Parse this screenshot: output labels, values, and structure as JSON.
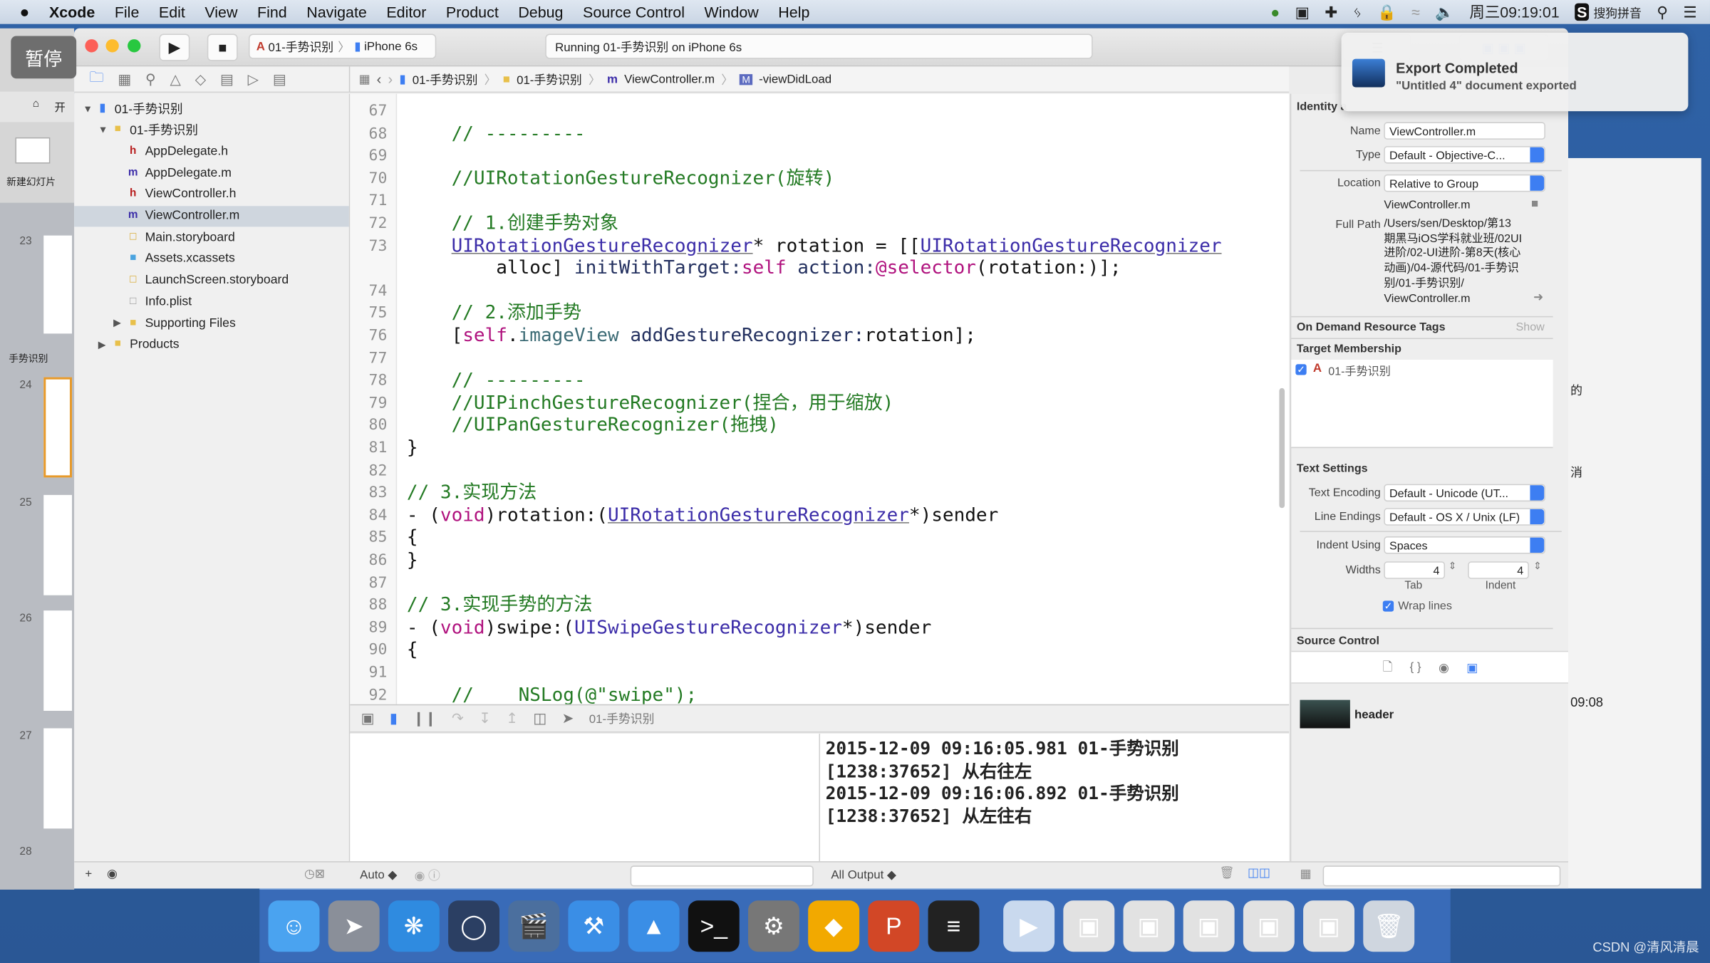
{
  "menubar": {
    "apple": "",
    "app": "Xcode",
    "items": [
      "File",
      "Edit",
      "View",
      "Find",
      "Navigate",
      "Editor",
      "Product",
      "Debug",
      "Source Control",
      "Window",
      "Help"
    ],
    "clock": "周三09:19:01",
    "ime": "搜狗拼音"
  },
  "overlay": {
    "pause": "暂停"
  },
  "keynote": {
    "home": "开",
    "new_slide": "新建幻灯片",
    "section": "手势识别",
    "slides": [
      "23",
      "24",
      "25",
      "26",
      "27",
      "28"
    ]
  },
  "toolbar": {
    "scheme": "01-手势识别",
    "device": "iPhone 6s",
    "status": "Running 01-手势识别 on iPhone 6s"
  },
  "jumpbar": {
    "crumbs": [
      "01-手势识别",
      "01-手势识别",
      "ViewController.m",
      "-viewDidLoad"
    ]
  },
  "navigator": {
    "items": [
      {
        "label": "01-手势识别",
        "kind": "project",
        "depth": 0,
        "disclosure": "open"
      },
      {
        "label": "01-手势识别",
        "kind": "folder",
        "depth": 1,
        "disclosure": "open"
      },
      {
        "label": "AppDelegate.h",
        "kind": "h",
        "depth": 2
      },
      {
        "label": "AppDelegate.m",
        "kind": "m",
        "depth": 2
      },
      {
        "label": "ViewController.h",
        "kind": "h",
        "depth": 2
      },
      {
        "label": "ViewController.m",
        "kind": "m",
        "depth": 2,
        "selected": true
      },
      {
        "label": "Main.storyboard",
        "kind": "storyboard",
        "depth": 2
      },
      {
        "label": "Assets.xcassets",
        "kind": "assets",
        "depth": 2
      },
      {
        "label": "LaunchScreen.storyboard",
        "kind": "storyboard",
        "depth": 2
      },
      {
        "label": "Info.plist",
        "kind": "plist",
        "depth": 2
      },
      {
        "label": "Supporting Files",
        "kind": "folder",
        "depth": 2,
        "disclosure": "closed"
      },
      {
        "label": "Products",
        "kind": "folder",
        "depth": 1,
        "disclosure": "closed"
      }
    ]
  },
  "code": {
    "lines": [
      {
        "n": "67",
        "tokens": []
      },
      {
        "n": "68",
        "tokens": [
          {
            "c": "cm",
            "t": "    // ---------"
          }
        ]
      },
      {
        "n": "69",
        "tokens": []
      },
      {
        "n": "70",
        "tokens": [
          {
            "c": "cm",
            "t": "    //UIRotationGestureRecognizer(旋转)"
          }
        ]
      },
      {
        "n": "71",
        "tokens": []
      },
      {
        "n": "72",
        "tokens": [
          {
            "c": "cm",
            "t": "    // 1.创建手势对象"
          }
        ]
      },
      {
        "n": "73",
        "tokens": [
          {
            "c": "pl",
            "t": "    "
          },
          {
            "c": "ty ul",
            "t": "UIRotationGestureRecognizer"
          },
          {
            "c": "pl",
            "t": "* rotation = [["
          },
          {
            "c": "ty ul",
            "t": "UIRotationGestureRecognizer"
          }
        ]
      },
      {
        "n": "",
        "tokens": [
          {
            "c": "pl",
            "t": "        alloc] "
          },
          {
            "c": "me",
            "t": "initWithTarget:"
          },
          {
            "c": "kw",
            "t": "self"
          },
          {
            "c": "me",
            "t": " action:"
          },
          {
            "c": "kw",
            "t": "@selector"
          },
          {
            "c": "pl",
            "t": "(rotation:)];"
          }
        ]
      },
      {
        "n": "74",
        "tokens": []
      },
      {
        "n": "75",
        "tokens": [
          {
            "c": "cm",
            "t": "    // 2.添加手势"
          }
        ]
      },
      {
        "n": "76",
        "tokens": [
          {
            "c": "pl",
            "t": "    ["
          },
          {
            "c": "kw",
            "t": "self"
          },
          {
            "c": "pl",
            "t": "."
          },
          {
            "c": "pr",
            "t": "imageView"
          },
          {
            "c": "pl",
            "t": " "
          },
          {
            "c": "me",
            "t": "addGestureRecognizer:"
          },
          {
            "c": "pl",
            "t": "rotation];"
          }
        ]
      },
      {
        "n": "77",
        "tokens": []
      },
      {
        "n": "78",
        "tokens": [
          {
            "c": "cm",
            "t": "    // ---------"
          }
        ]
      },
      {
        "n": "79",
        "tokens": [
          {
            "c": "cm",
            "t": "    //UIPinchGestureRecognizer(捏合，用于缩放)"
          }
        ]
      },
      {
        "n": "80",
        "tokens": [
          {
            "c": "cm",
            "t": "    //UIPanGestureRecognizer(拖拽)"
          }
        ]
      },
      {
        "n": "81",
        "tokens": [
          {
            "c": "pl",
            "t": "}"
          }
        ]
      },
      {
        "n": "82",
        "tokens": []
      },
      {
        "n": "83",
        "tokens": [
          {
            "c": "cm",
            "t": "// 3.实现方法"
          }
        ]
      },
      {
        "n": "84",
        "tokens": [
          {
            "c": "pl",
            "t": "- ("
          },
          {
            "c": "kw",
            "t": "void"
          },
          {
            "c": "pl",
            "t": ")rotation:("
          },
          {
            "c": "ty ul",
            "t": "UIRotationGestureRecognizer"
          },
          {
            "c": "pl",
            "t": "*)sender"
          }
        ]
      },
      {
        "n": "85",
        "tokens": [
          {
            "c": "pl",
            "t": "{"
          }
        ]
      },
      {
        "n": "86",
        "tokens": [
          {
            "c": "pl",
            "t": "}"
          }
        ]
      },
      {
        "n": "87",
        "tokens": []
      },
      {
        "n": "88",
        "tokens": [
          {
            "c": "cm",
            "t": "// 3.实现手势的方法"
          }
        ]
      },
      {
        "n": "89",
        "tokens": [
          {
            "c": "pl",
            "t": "- ("
          },
          {
            "c": "kw",
            "t": "void"
          },
          {
            "c": "pl",
            "t": ")swipe:("
          },
          {
            "c": "ty",
            "t": "UISwipeGestureRecognizer"
          },
          {
            "c": "pl",
            "t": "*)sender"
          }
        ]
      },
      {
        "n": "90",
        "tokens": [
          {
            "c": "pl",
            "t": "{"
          }
        ]
      },
      {
        "n": "91",
        "tokens": []
      },
      {
        "n": "92",
        "tokens": [
          {
            "c": "cm",
            "t": "    //    NSLog(@\"swipe\");"
          }
        ]
      }
    ]
  },
  "debug": {
    "target": "01-手势识别",
    "auto": "Auto ◆",
    "output": "All Output ◆"
  },
  "console": {
    "lines": [
      "2015-12-09 09:16:05.981 01-手势识别",
      "[1238:37652] 从右往左",
      "2015-12-09 09:16:06.892 01-手势识别",
      "[1238:37652] 从左往右"
    ]
  },
  "inspector": {
    "identity_title": "Identity a",
    "name_label": "Name",
    "name_value": "ViewController.m",
    "type_label": "Type",
    "type_value": "Default - Objective-C...",
    "location_label": "Location",
    "location_value": "Relative to Group",
    "location_file": "ViewController.m",
    "fullpath_label": "Full Path",
    "fullpath_lines": [
      "/Users/sen/Desktop/第13",
      "期黑马iOS学科就业班/02UI",
      "进阶/02-UI进阶-第8天(核心",
      "动画)/04-源代码/01-手势识",
      "别/01-手势识别/",
      "ViewController.m"
    ],
    "odr_title": "On Demand Resource Tags",
    "odr_show": "Show",
    "target_title": "Target Membership",
    "target_item": "01-手势识别",
    "target_checked": true,
    "text_title": "Text Settings",
    "encoding_label": "Text Encoding",
    "encoding_value": "Default - Unicode (UT...",
    "endings_label": "Line Endings",
    "endings_value": "Default - OS X / Unix (LF)",
    "indent_label": "Indent Using",
    "indent_value": "Spaces",
    "widths_label": "Widths",
    "tab_value": "4",
    "indent_width_value": "4",
    "tab_label": "Tab",
    "indent_sub_label": "Indent",
    "wrap_label": "Wrap lines",
    "wrap_checked": true,
    "sc_title": "Source Control",
    "library_item": "header"
  },
  "notification": {
    "title": "Export Completed",
    "body": "\"Untitled 4\" document exported"
  },
  "behind_window": {
    "texts": [
      "的",
      "消",
      "09:08"
    ]
  },
  "dock": {
    "apps": [
      "finder-icon",
      "launchpad-icon",
      "safari-icon",
      "mouse-app-icon",
      "keynote-export-icon",
      "xcode-icon",
      "instruments-icon",
      "terminal-icon",
      "system-preferences-icon",
      "sketch-icon",
      "powerpoint-icon",
      "console-icon",
      "preview-icon",
      "window-thumb-icon",
      "window-thumb-icon",
      "window-thumb-icon",
      "window-thumb-icon",
      "window-thumb-icon",
      "trash-icon"
    ]
  },
  "watermark": "CSDN @清风清晨",
  "colors": {
    "accent": "#3d7ef2",
    "desktop": "#2a5b9c",
    "comment": "#237a23",
    "type": "#3b2ca8",
    "keyword": "#b0127e"
  }
}
